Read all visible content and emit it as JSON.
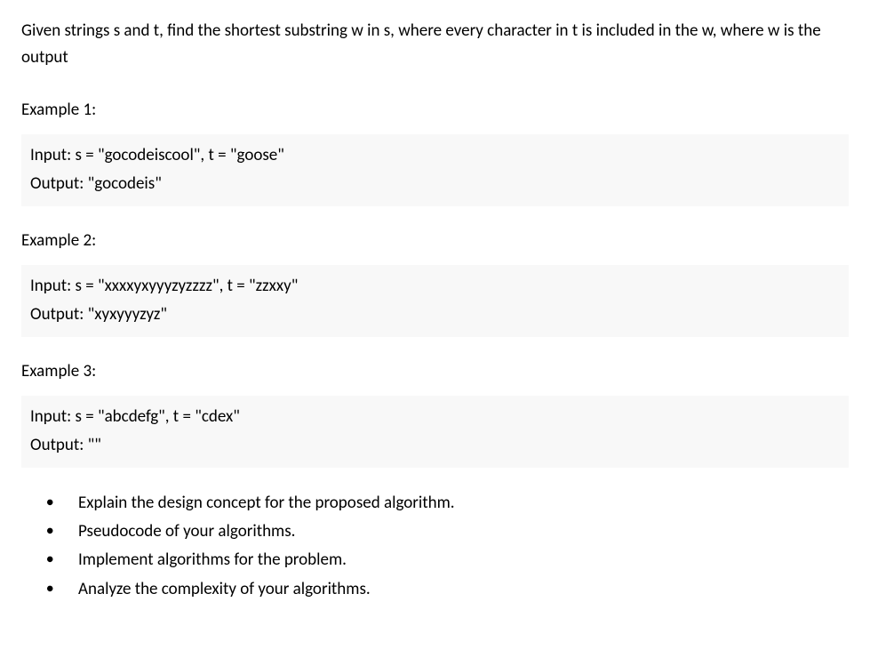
{
  "problem": {
    "statement": "Given strings s and t, find the shortest substring w in s, where every character in t is included in the w, where w is the output"
  },
  "examples": [
    {
      "title": "Example 1:",
      "input": "Input: s = \"gocodeiscool\", t = \"goose\"",
      "output": "Output: \"gocodeis\""
    },
    {
      "title": "Example 2:",
      "input": "Input: s = \"xxxxyxyyyzyzzzz\", t = \"zzxxy\"",
      "output": "Output: \"xyxyyyzyz\""
    },
    {
      "title": "Example 3:",
      "input": "Input: s = \"abcdefg\", t = \"cdex\"",
      "output": "Output: \"\""
    }
  ],
  "tasks": [
    "Explain the design concept for the proposed algorithm.",
    "Pseudocode of your algorithms.",
    "Implement algorithms for the problem.",
    "Analyze the complexity of your algorithms."
  ]
}
